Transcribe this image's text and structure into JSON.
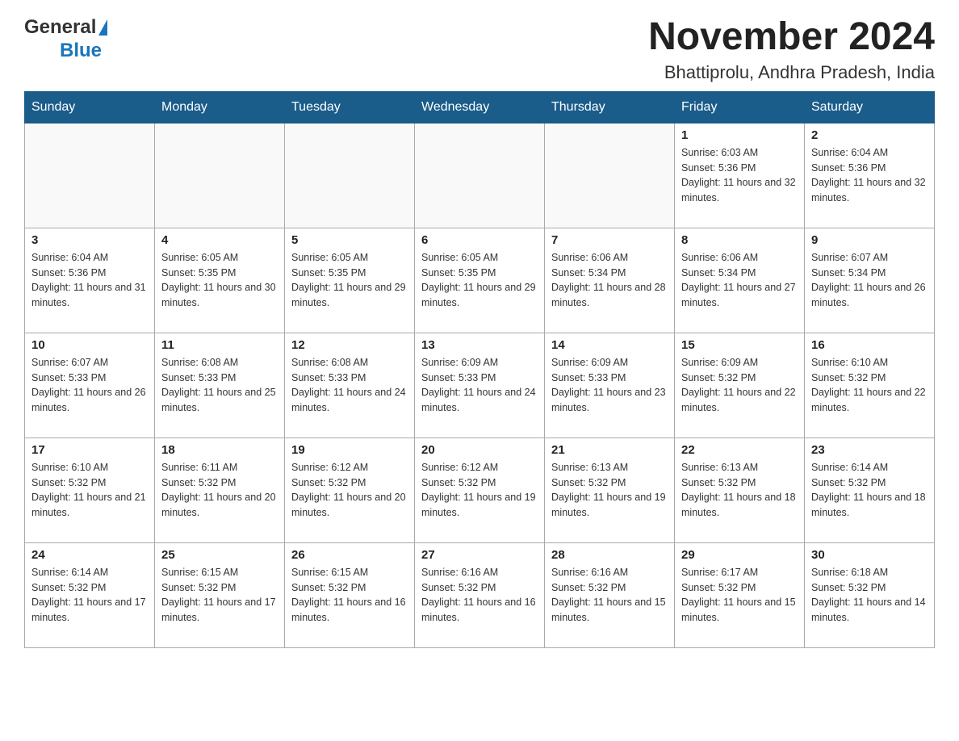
{
  "header": {
    "logo_general": "General",
    "logo_blue": "Blue",
    "title": "November 2024",
    "subtitle": "Bhattiprolu, Andhra Pradesh, India"
  },
  "calendar": {
    "days_of_week": [
      "Sunday",
      "Monday",
      "Tuesday",
      "Wednesday",
      "Thursday",
      "Friday",
      "Saturday"
    ],
    "weeks": [
      [
        {
          "day": "",
          "info": ""
        },
        {
          "day": "",
          "info": ""
        },
        {
          "day": "",
          "info": ""
        },
        {
          "day": "",
          "info": ""
        },
        {
          "day": "",
          "info": ""
        },
        {
          "day": "1",
          "info": "Sunrise: 6:03 AM\nSunset: 5:36 PM\nDaylight: 11 hours and 32 minutes."
        },
        {
          "day": "2",
          "info": "Sunrise: 6:04 AM\nSunset: 5:36 PM\nDaylight: 11 hours and 32 minutes."
        }
      ],
      [
        {
          "day": "3",
          "info": "Sunrise: 6:04 AM\nSunset: 5:36 PM\nDaylight: 11 hours and 31 minutes."
        },
        {
          "day": "4",
          "info": "Sunrise: 6:05 AM\nSunset: 5:35 PM\nDaylight: 11 hours and 30 minutes."
        },
        {
          "day": "5",
          "info": "Sunrise: 6:05 AM\nSunset: 5:35 PM\nDaylight: 11 hours and 29 minutes."
        },
        {
          "day": "6",
          "info": "Sunrise: 6:05 AM\nSunset: 5:35 PM\nDaylight: 11 hours and 29 minutes."
        },
        {
          "day": "7",
          "info": "Sunrise: 6:06 AM\nSunset: 5:34 PM\nDaylight: 11 hours and 28 minutes."
        },
        {
          "day": "8",
          "info": "Sunrise: 6:06 AM\nSunset: 5:34 PM\nDaylight: 11 hours and 27 minutes."
        },
        {
          "day": "9",
          "info": "Sunrise: 6:07 AM\nSunset: 5:34 PM\nDaylight: 11 hours and 26 minutes."
        }
      ],
      [
        {
          "day": "10",
          "info": "Sunrise: 6:07 AM\nSunset: 5:33 PM\nDaylight: 11 hours and 26 minutes."
        },
        {
          "day": "11",
          "info": "Sunrise: 6:08 AM\nSunset: 5:33 PM\nDaylight: 11 hours and 25 minutes."
        },
        {
          "day": "12",
          "info": "Sunrise: 6:08 AM\nSunset: 5:33 PM\nDaylight: 11 hours and 24 minutes."
        },
        {
          "day": "13",
          "info": "Sunrise: 6:09 AM\nSunset: 5:33 PM\nDaylight: 11 hours and 24 minutes."
        },
        {
          "day": "14",
          "info": "Sunrise: 6:09 AM\nSunset: 5:33 PM\nDaylight: 11 hours and 23 minutes."
        },
        {
          "day": "15",
          "info": "Sunrise: 6:09 AM\nSunset: 5:32 PM\nDaylight: 11 hours and 22 minutes."
        },
        {
          "day": "16",
          "info": "Sunrise: 6:10 AM\nSunset: 5:32 PM\nDaylight: 11 hours and 22 minutes."
        }
      ],
      [
        {
          "day": "17",
          "info": "Sunrise: 6:10 AM\nSunset: 5:32 PM\nDaylight: 11 hours and 21 minutes."
        },
        {
          "day": "18",
          "info": "Sunrise: 6:11 AM\nSunset: 5:32 PM\nDaylight: 11 hours and 20 minutes."
        },
        {
          "day": "19",
          "info": "Sunrise: 6:12 AM\nSunset: 5:32 PM\nDaylight: 11 hours and 20 minutes."
        },
        {
          "day": "20",
          "info": "Sunrise: 6:12 AM\nSunset: 5:32 PM\nDaylight: 11 hours and 19 minutes."
        },
        {
          "day": "21",
          "info": "Sunrise: 6:13 AM\nSunset: 5:32 PM\nDaylight: 11 hours and 19 minutes."
        },
        {
          "day": "22",
          "info": "Sunrise: 6:13 AM\nSunset: 5:32 PM\nDaylight: 11 hours and 18 minutes."
        },
        {
          "day": "23",
          "info": "Sunrise: 6:14 AM\nSunset: 5:32 PM\nDaylight: 11 hours and 18 minutes."
        }
      ],
      [
        {
          "day": "24",
          "info": "Sunrise: 6:14 AM\nSunset: 5:32 PM\nDaylight: 11 hours and 17 minutes."
        },
        {
          "day": "25",
          "info": "Sunrise: 6:15 AM\nSunset: 5:32 PM\nDaylight: 11 hours and 17 minutes."
        },
        {
          "day": "26",
          "info": "Sunrise: 6:15 AM\nSunset: 5:32 PM\nDaylight: 11 hours and 16 minutes."
        },
        {
          "day": "27",
          "info": "Sunrise: 6:16 AM\nSunset: 5:32 PM\nDaylight: 11 hours and 16 minutes."
        },
        {
          "day": "28",
          "info": "Sunrise: 6:16 AM\nSunset: 5:32 PM\nDaylight: 11 hours and 15 minutes."
        },
        {
          "day": "29",
          "info": "Sunrise: 6:17 AM\nSunset: 5:32 PM\nDaylight: 11 hours and 15 minutes."
        },
        {
          "day": "30",
          "info": "Sunrise: 6:18 AM\nSunset: 5:32 PM\nDaylight: 11 hours and 14 minutes."
        }
      ]
    ]
  }
}
